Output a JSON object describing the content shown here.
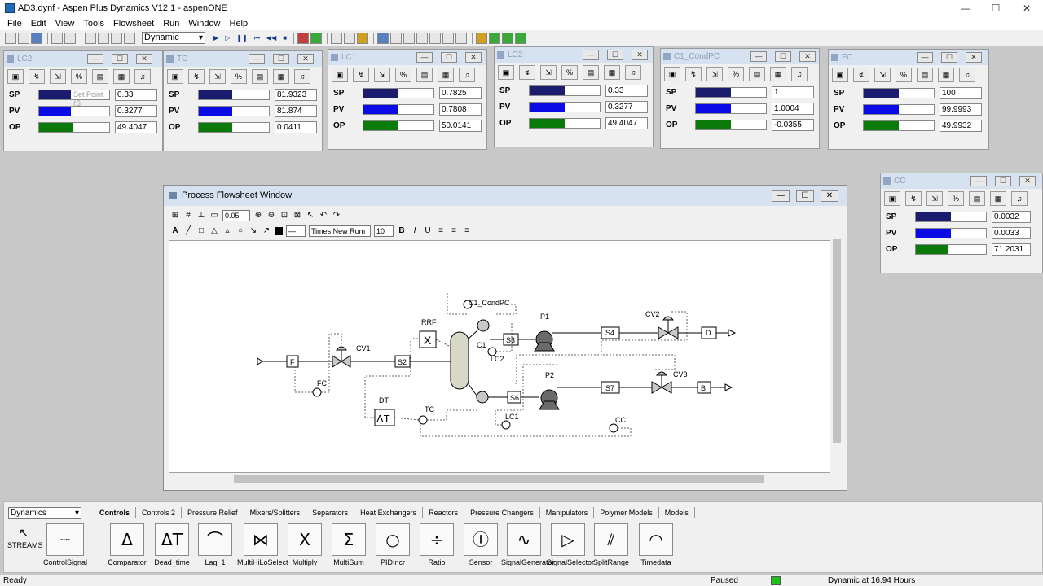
{
  "window": {
    "title": "AD3.dynf - Aspen Plus Dynamics V12.1 - aspenONE",
    "minimize": "—",
    "maximize": "☐",
    "close": "✕"
  },
  "menu": [
    "File",
    "Edit",
    "View",
    "Tools",
    "Flowsheet",
    "Run",
    "Window",
    "Help"
  ],
  "toolbar": {
    "mode": "Dynamic"
  },
  "faceplates": [
    {
      "name": "LC2",
      "sp": "0.33",
      "pv": "0.3277",
      "op": "49.4047",
      "sp_level": 0.45,
      "pv_level": 0.45,
      "op_level": 0.49,
      "tooltip": "Set Point (S"
    },
    {
      "name": "TC",
      "sp": "81.9323",
      "pv": "81.874",
      "op": "0.0411",
      "sp_level": 0.48,
      "pv_level": 0.48,
      "op_level": 0.48
    },
    {
      "name": "LC1",
      "sp": "0.7825",
      "pv": "0.7808",
      "op": "50.0141",
      "sp_level": 0.5,
      "pv_level": 0.5,
      "op_level": 0.5
    },
    {
      "name": "LC2",
      "sp": "0.33",
      "pv": "0.3277",
      "op": "49.4047",
      "sp_level": 0.5,
      "pv_level": 0.5,
      "op_level": 0.5
    },
    {
      "name": "C1_CondPC",
      "sp": "1",
      "pv": "1.0004",
      "op": "-0.0355",
      "sp_level": 0.5,
      "pv_level": 0.5,
      "op_level": 0.5
    },
    {
      "name": "FC",
      "sp": "100",
      "pv": "99.9993",
      "op": "49.9932",
      "sp_level": 0.5,
      "pv_level": 0.5,
      "op_level": 0.5
    }
  ],
  "faceplate_labels": {
    "sp": "SP",
    "pv": "PV",
    "op": "OP"
  },
  "faceplate_tools": [
    "▣",
    "↯",
    "⇲",
    "%",
    "▤",
    "▦",
    "♫"
  ],
  "cc": {
    "name": "CC",
    "sp": "0.0032",
    "pv": "0.0033",
    "op": "71.2031",
    "sp_level": 0.5,
    "pv_level": 0.5,
    "op_level": 0.45
  },
  "flowsheet": {
    "title": "Process Flowsheet Window",
    "grid_value": "0.05",
    "font_name": "Times New Rom",
    "font_size": "10",
    "bold": "B",
    "italic": "I",
    "underline": "U",
    "labels": {
      "c1_condpc": "C1_CondPC",
      "rrf": "RRF",
      "p1": "P1",
      "cv2": "CV2",
      "s4": "S4",
      "d": "D",
      "cv1": "CV1",
      "f": "F",
      "s2": "S2",
      "s3": "S3",
      "c1": "C1",
      "lc2": "LC2",
      "fc": "FC",
      "p2": "P2",
      "cv3": "CV3",
      "s7": "S7",
      "b": "B",
      "dt": "DT",
      "tc": "TC",
      "s6": "S6",
      "lc1": "LC1",
      "cc": "CC",
      "x": "X",
      "dt_symbol": "ΔT"
    }
  },
  "palette": {
    "library": "Dynamics",
    "tabs": [
      "Controls",
      "Controls 2",
      "Pressure Relief",
      "Mixers/Splitters",
      "Separators",
      "Heat Exchangers",
      "Reactors",
      "Pressure Changers",
      "Manipulators",
      "Polymer Models",
      "Models"
    ],
    "streams_label": "STREAMS",
    "items": [
      {
        "name": "ControlSignal",
        "glyph": "┈"
      },
      {
        "name": "Comparator",
        "glyph": "Δ"
      },
      {
        "name": "Dead_time",
        "glyph": "ΔT"
      },
      {
        "name": "Lag_1",
        "glyph": "⌒"
      },
      {
        "name": "MultiHiLoSelect",
        "glyph": "⋈"
      },
      {
        "name": "Multiply",
        "glyph": "X"
      },
      {
        "name": "MultiSum",
        "glyph": "Σ"
      },
      {
        "name": "PIDIncr",
        "glyph": "○"
      },
      {
        "name": "Ratio",
        "glyph": "÷"
      },
      {
        "name": "Sensor",
        "glyph": "Ⓘ"
      },
      {
        "name": "SignalGenerator",
        "glyph": "∿"
      },
      {
        "name": "SignalSelector",
        "glyph": "▷"
      },
      {
        "name": "SplitRange",
        "glyph": "⫽"
      },
      {
        "name": "Timedata",
        "glyph": "◠"
      }
    ]
  },
  "status": {
    "left": "Ready",
    "run_state": "Paused",
    "time": "Dynamic at 16.94 Hours"
  },
  "colors": {
    "sp": "#1c1c6e",
    "pv": "#0a0ae6",
    "op": "#0a7a0a",
    "run_led": "#1cc11c"
  }
}
